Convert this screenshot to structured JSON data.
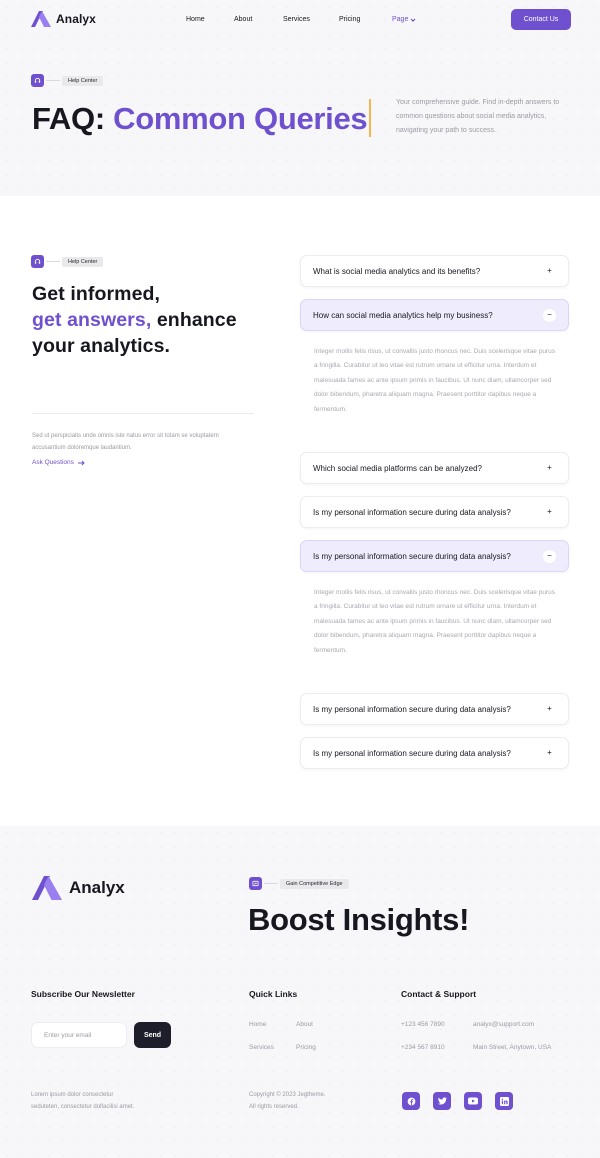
{
  "brand": {
    "name": "Analyx"
  },
  "nav": {
    "items": [
      "Home",
      "About",
      "Services",
      "Pricing",
      "Page"
    ],
    "cta": "Contact Us"
  },
  "hero": {
    "tag": "Help Center",
    "title_a": "FAQ: ",
    "title_b": "Common Queries",
    "desc": "Your comprehensive guide. Find in-depth answers to common questions about social media analytics, navigating your path to success."
  },
  "faq": {
    "tag": "Help Center",
    "heading_1": "Get informed,",
    "heading_2a": "get answers,",
    "heading_2b": " enhance",
    "heading_3": "your analytics.",
    "side_desc": "Sed ut perspiciatis unde omnis iste natus error sit totam se voluptatem accusantium doloremque laudantium.",
    "ask_link": "Ask Questions",
    "questions": [
      "What is social media analytics and its benefits?",
      "How can social media analytics help my business?",
      "Which social media platforms can be analyzed?",
      "Is my personal information secure during data analysis?",
      "Is my personal information secure during data analysis?",
      "Is my personal information secure during data analysis?",
      "Is my personal information secure during data analysis?"
    ],
    "answer": "Integer mollis felis risus, ut convallis justo rhoncus nec. Duis scelerisque vitae purus a fringilla. Curabitur ut leo vitae est rutrum ornare ut efficitur urna. Interdum et malesuada fames ac ante ipsum primis in faucibus. Ut nunc diam, ullamcorper sed dolor bibendum, pharetra aliquam magna. Praesent porttitor dapibus neque a fermentum."
  },
  "footer": {
    "tag": "Gain Competitive Edge",
    "boost": "Boost Insights!",
    "newsletter_title": "Subscribe Our Newsletter",
    "email_placeholder": "Enter your email",
    "send": "Send",
    "quick_title": "Quick Links",
    "links": [
      "Home",
      "About",
      "Services",
      "Pricing"
    ],
    "contact_title": "Contact & Support",
    "phone_1": "+123 456 7890",
    "phone_2": "+234 567 8910",
    "email": "analyx@support.com",
    "address": "Main Street, Anytown, USA",
    "lorem_1": "Lorem ipsum dolor consectetur",
    "lorem_2": "seduteten, consectetur dolfacilisi amet.",
    "copy_1": "Copyright © 2023 Jegtheme.",
    "copy_2": "All rights reserved.",
    "social": [
      "facebook-icon",
      "twitter-icon",
      "youtube-icon",
      "linkedin-icon"
    ]
  },
  "colors": {
    "accent": "#6f51cf",
    "dark": "#17171f",
    "muted": "#9a9aa3",
    "highlight": "#f2b84e"
  }
}
